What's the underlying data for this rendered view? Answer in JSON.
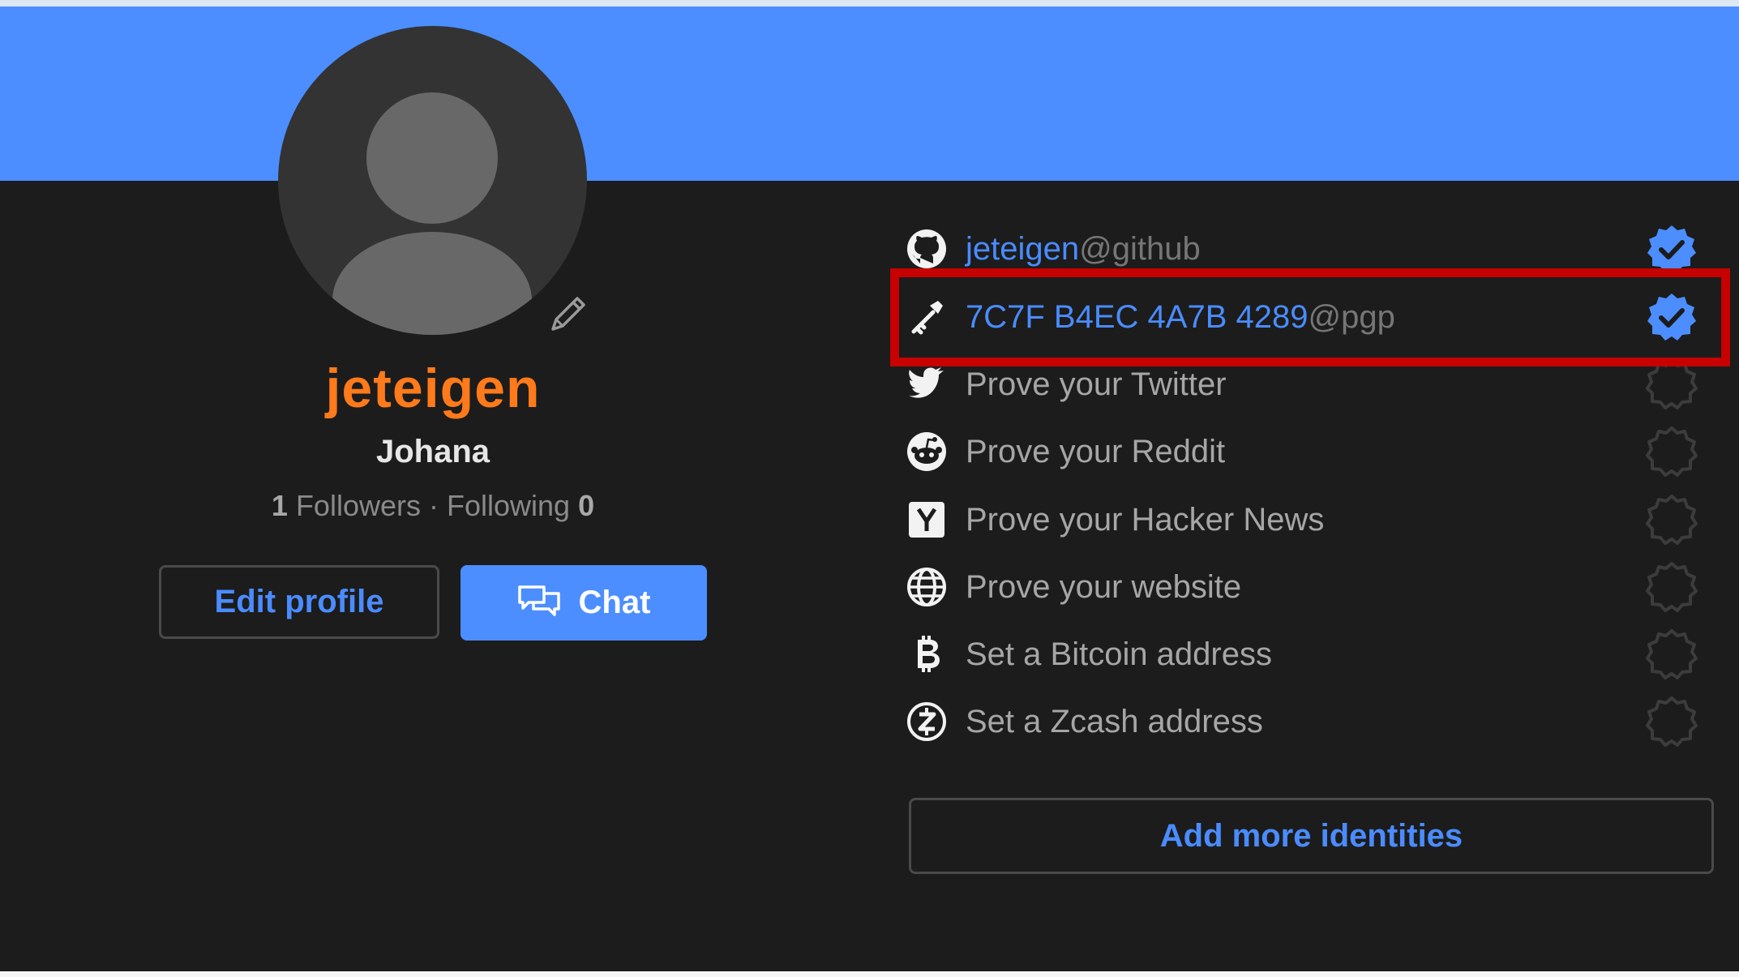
{
  "profile": {
    "username": "jeteigen",
    "full_name": "Johana",
    "followers_count": "1",
    "followers_label": "Followers",
    "separator": " · ",
    "following_label": "Following",
    "following_count": "0",
    "edit_profile_label": "Edit profile",
    "chat_label": "Chat"
  },
  "identities": [
    {
      "name": "jeteigen",
      "service": "@github",
      "icon": "github-icon",
      "verified": true
    },
    {
      "name": "7C7F B4EC 4A7B 4289",
      "service": "@pgp",
      "icon": "key-icon",
      "verified": true
    },
    {
      "label": "Prove your Twitter",
      "icon": "twitter-icon",
      "verified": false
    },
    {
      "label": "Prove your Reddit",
      "icon": "reddit-icon",
      "verified": false
    },
    {
      "label": "Prove your Hacker News",
      "icon": "hackernews-icon",
      "verified": false
    },
    {
      "label": "Prove your website",
      "icon": "globe-icon",
      "verified": false
    },
    {
      "label": "Set a Bitcoin address",
      "icon": "bitcoin-icon",
      "verified": false
    },
    {
      "label": "Set a Zcash address",
      "icon": "zcash-icon",
      "verified": false
    }
  ],
  "add_identities_label": "Add more identities",
  "colors": {
    "banner": "#4c8eff",
    "username": "#ff7a1a",
    "link": "#4a8cff",
    "highlight": "#c70000",
    "background": "#1c1c1c"
  }
}
